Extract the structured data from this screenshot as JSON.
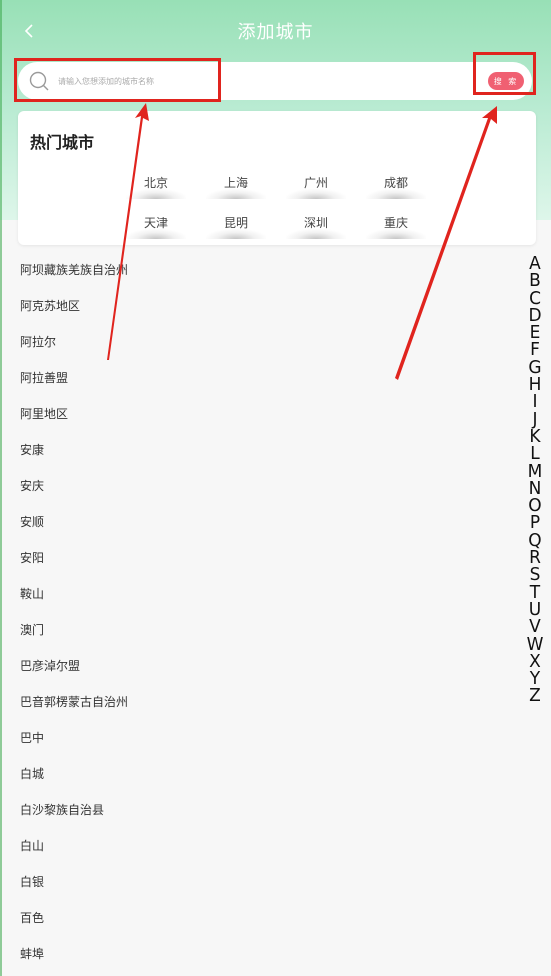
{
  "header": {
    "title": "添加城市",
    "back_icon": "chevron-left-icon"
  },
  "search": {
    "placeholder": "请输入您想添加的城市名称",
    "value": "",
    "button_label": "搜 索",
    "icon": "search-icon"
  },
  "hot": {
    "title": "热门城市",
    "cities": [
      "北京",
      "上海",
      "广州",
      "成都",
      "天津",
      "昆明",
      "深圳",
      "重庆"
    ]
  },
  "cities": [
    "阿坝藏族羌族自治州",
    "阿克苏地区",
    "阿拉尔",
    "阿拉善盟",
    "阿里地区",
    "安康",
    "安庆",
    "安顺",
    "安阳",
    "鞍山",
    "澳门",
    "巴彦淖尔盟",
    "巴音郭楞蒙古自治州",
    "巴中",
    "白城",
    "白沙黎族自治县",
    "白山",
    "白银",
    "百色",
    "蚌埠"
  ],
  "alphabet": [
    "A",
    "B",
    "C",
    "D",
    "E",
    "F",
    "G",
    "H",
    "I",
    "J",
    "K",
    "L",
    "M",
    "N",
    "O",
    "P",
    "Q",
    "R",
    "S",
    "T",
    "U",
    "V",
    "W",
    "X",
    "Y",
    "Z"
  ],
  "colors": {
    "header_green": "#98e0b6",
    "accent_red": "#f06072",
    "annotation_red": "#e0241e"
  }
}
